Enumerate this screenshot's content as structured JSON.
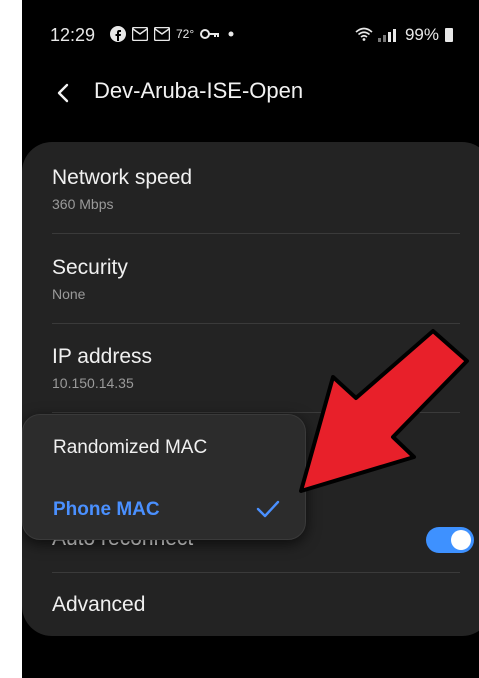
{
  "status_bar": {
    "time": "12:29",
    "temperature": "72°",
    "battery": "99%",
    "icons": [
      "facebook-icon",
      "gmail-icon",
      "gmail-icon",
      "key-icon",
      "dot-icon",
      "wifi-icon",
      "signal-icon",
      "battery-icon"
    ]
  },
  "header": {
    "title": "Dev-Aruba-ISE-Open"
  },
  "settings": {
    "network_speed": {
      "label": "Network speed",
      "value": "360 Mbps"
    },
    "security": {
      "label": "Security",
      "value": "None"
    },
    "ip_address": {
      "label": "IP address",
      "value": "10.150.14.35"
    },
    "auto_reconnect": {
      "label": "Auto reconnect",
      "enabled": true
    },
    "advanced": {
      "label": "Advanced"
    }
  },
  "mac_menu": {
    "options": [
      "Randomized MAC",
      "Phone MAC"
    ],
    "selected": "Phone MAC"
  },
  "colors": {
    "background": "#000000",
    "card": "#232323",
    "accent": "#4a90ff",
    "arrow": "#e8202a"
  }
}
